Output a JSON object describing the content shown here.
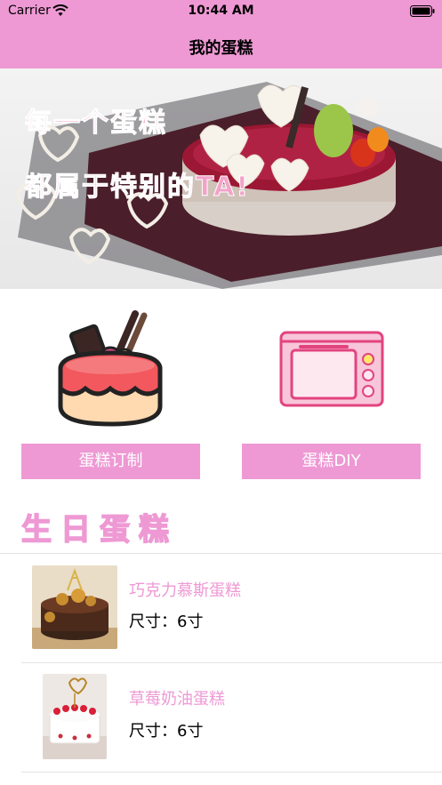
{
  "status_bar": {
    "carrier": "Carrier",
    "time": "10:44 AM",
    "wifi_icon": "wifi-icon",
    "battery_icon": "battery-icon"
  },
  "nav": {
    "title": "我的蛋糕"
  },
  "banner": {
    "line1": "每一个蛋糕",
    "line2": "都属于特别的TA!"
  },
  "features": [
    {
      "label": "蛋糕订制",
      "icon": "cake-icon"
    },
    {
      "label": "蛋糕DIY",
      "icon": "oven-icon"
    }
  ],
  "section": {
    "title": "生日蛋糕"
  },
  "products": [
    {
      "name": "巧克力慕斯蛋糕",
      "size": "尺寸：6寸",
      "image": "chocolate-cake-photo"
    },
    {
      "name": "草莓奶油蛋糕",
      "size": "尺寸：6寸",
      "image": "strawberry-cake-photo"
    }
  ],
  "colors": {
    "accent": "#ee99d4",
    "white": "#ffffff",
    "divider": "#e3e3e3"
  }
}
